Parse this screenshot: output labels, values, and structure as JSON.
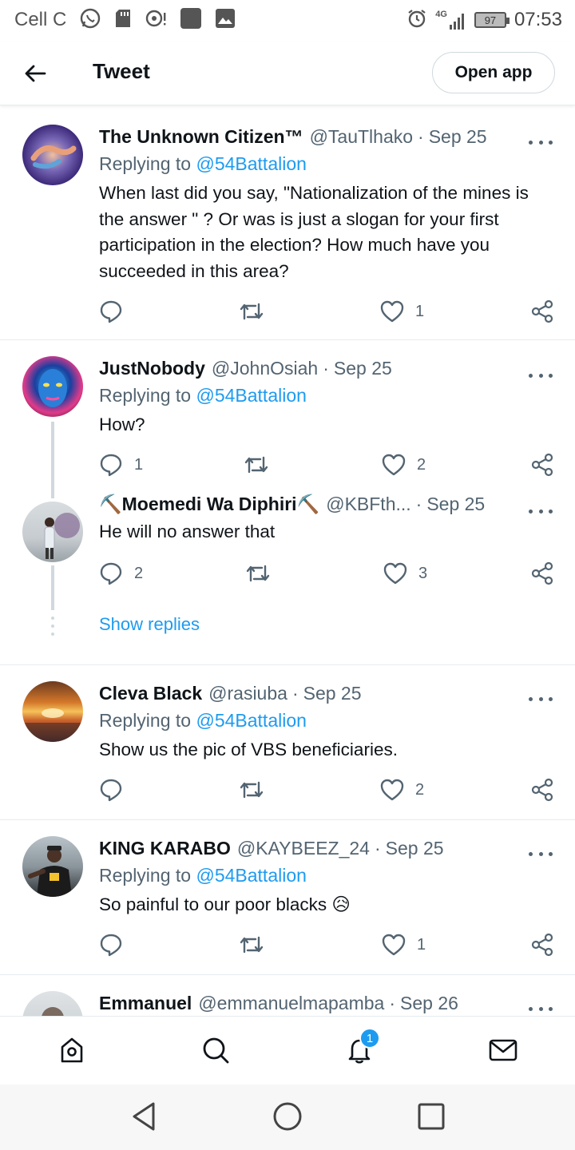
{
  "status_bar": {
    "carrier": "Cell C",
    "network": "4G",
    "battery": "97",
    "time": "07:53"
  },
  "header": {
    "title": "Tweet",
    "open_app_label": "Open app"
  },
  "tweets": [
    {
      "name": "The Unknown Citizen™",
      "handle": "@TauTlhako",
      "date": "Sep 25",
      "replying_prefix": "Replying to",
      "replying_to": "@54Battalion",
      "text": "When last did you say, \"Nationalization of the mines is the answer \" ? Or was is just a slogan for your first participation in the election? How much have you succeeded in this area?",
      "replies": "",
      "retweets": "",
      "likes": "1"
    },
    {
      "name": "JustNobody",
      "handle": "@JohnOsiah",
      "date": "Sep 25",
      "replying_prefix": "Replying to",
      "replying_to": "@54Battalion",
      "text": "How?",
      "replies": "1",
      "retweets": "",
      "likes": "2"
    },
    {
      "name": "⛏️Moemedi Wa Diphiri⛏️",
      "handle": "@KBFth...",
      "date": "Sep 25",
      "text": "He will no answer that",
      "replies": "2",
      "retweets": "",
      "likes": "3"
    },
    {
      "name": "Cleva Black",
      "handle": "@rasiuba",
      "date": "Sep 25",
      "replying_prefix": "Replying to",
      "replying_to": "@54Battalion",
      "text": "Show us the pic of VBS beneficiaries.",
      "replies": "",
      "retweets": "",
      "likes": "2"
    },
    {
      "name": "KING KARABO",
      "handle": "@KAYBEEZ_24",
      "date": "Sep 25",
      "replying_prefix": "Replying to",
      "replying_to": "@54Battalion",
      "text": "So painful to our poor blacks 😥",
      "replies": "",
      "retweets": "",
      "likes": "1"
    },
    {
      "name": "Emmanuel",
      "handle": "@emmanuelmapamba",
      "date": "Sep 26"
    }
  ],
  "show_replies_label": "Show replies",
  "tabbar": {
    "notifications_badge": "1",
    "tabs": [
      "home-icon",
      "search-icon",
      "notifications-icon",
      "messages-icon"
    ]
  },
  "colors": {
    "accent": "#1d9bf0",
    "secondary_text": "#536471",
    "divider": "#e6ecf0"
  }
}
